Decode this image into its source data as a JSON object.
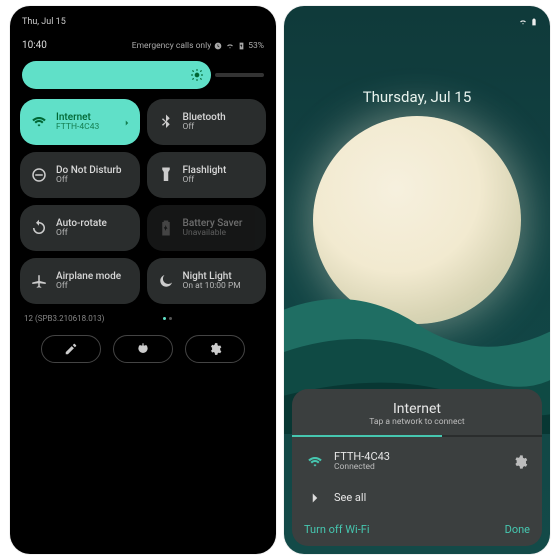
{
  "left": {
    "topbar_date": "Thu, Jul 15",
    "clock": "10:40",
    "emergency": "Emergency calls only",
    "battery_pct": "53%",
    "tiles": [
      {
        "icon": "wifi",
        "title": "Internet",
        "sub": "FTTH-4C43",
        "state": "on",
        "chevron": true
      },
      {
        "icon": "bluetooth",
        "title": "Bluetooth",
        "sub": "Off",
        "state": "off"
      },
      {
        "icon": "dnd",
        "title": "Do Not Disturb",
        "sub": "Off",
        "state": "off"
      },
      {
        "icon": "flashlight",
        "title": "Flashlight",
        "sub": "Off",
        "state": "off"
      },
      {
        "icon": "rotate",
        "title": "Auto-rotate",
        "sub": "Off",
        "state": "off"
      },
      {
        "icon": "battery",
        "title": "Battery Saver",
        "sub": "Unavailable",
        "state": "disabled"
      },
      {
        "icon": "airplane",
        "title": "Airplane mode",
        "sub": "Off",
        "state": "off"
      },
      {
        "icon": "moon",
        "title": "Night Light",
        "sub": "On at 10:00 PM",
        "state": "off"
      }
    ],
    "build": "12 (SPB3.210618.013)"
  },
  "right": {
    "date": "Thursday, Jul 15",
    "sheet": {
      "title": "Internet",
      "sub": "Tap a network to connect",
      "network_name": "FTTH-4C43",
      "network_status": "Connected",
      "see_all": "See all",
      "turn_off": "Turn off Wi-Fi",
      "done": "Done"
    }
  }
}
